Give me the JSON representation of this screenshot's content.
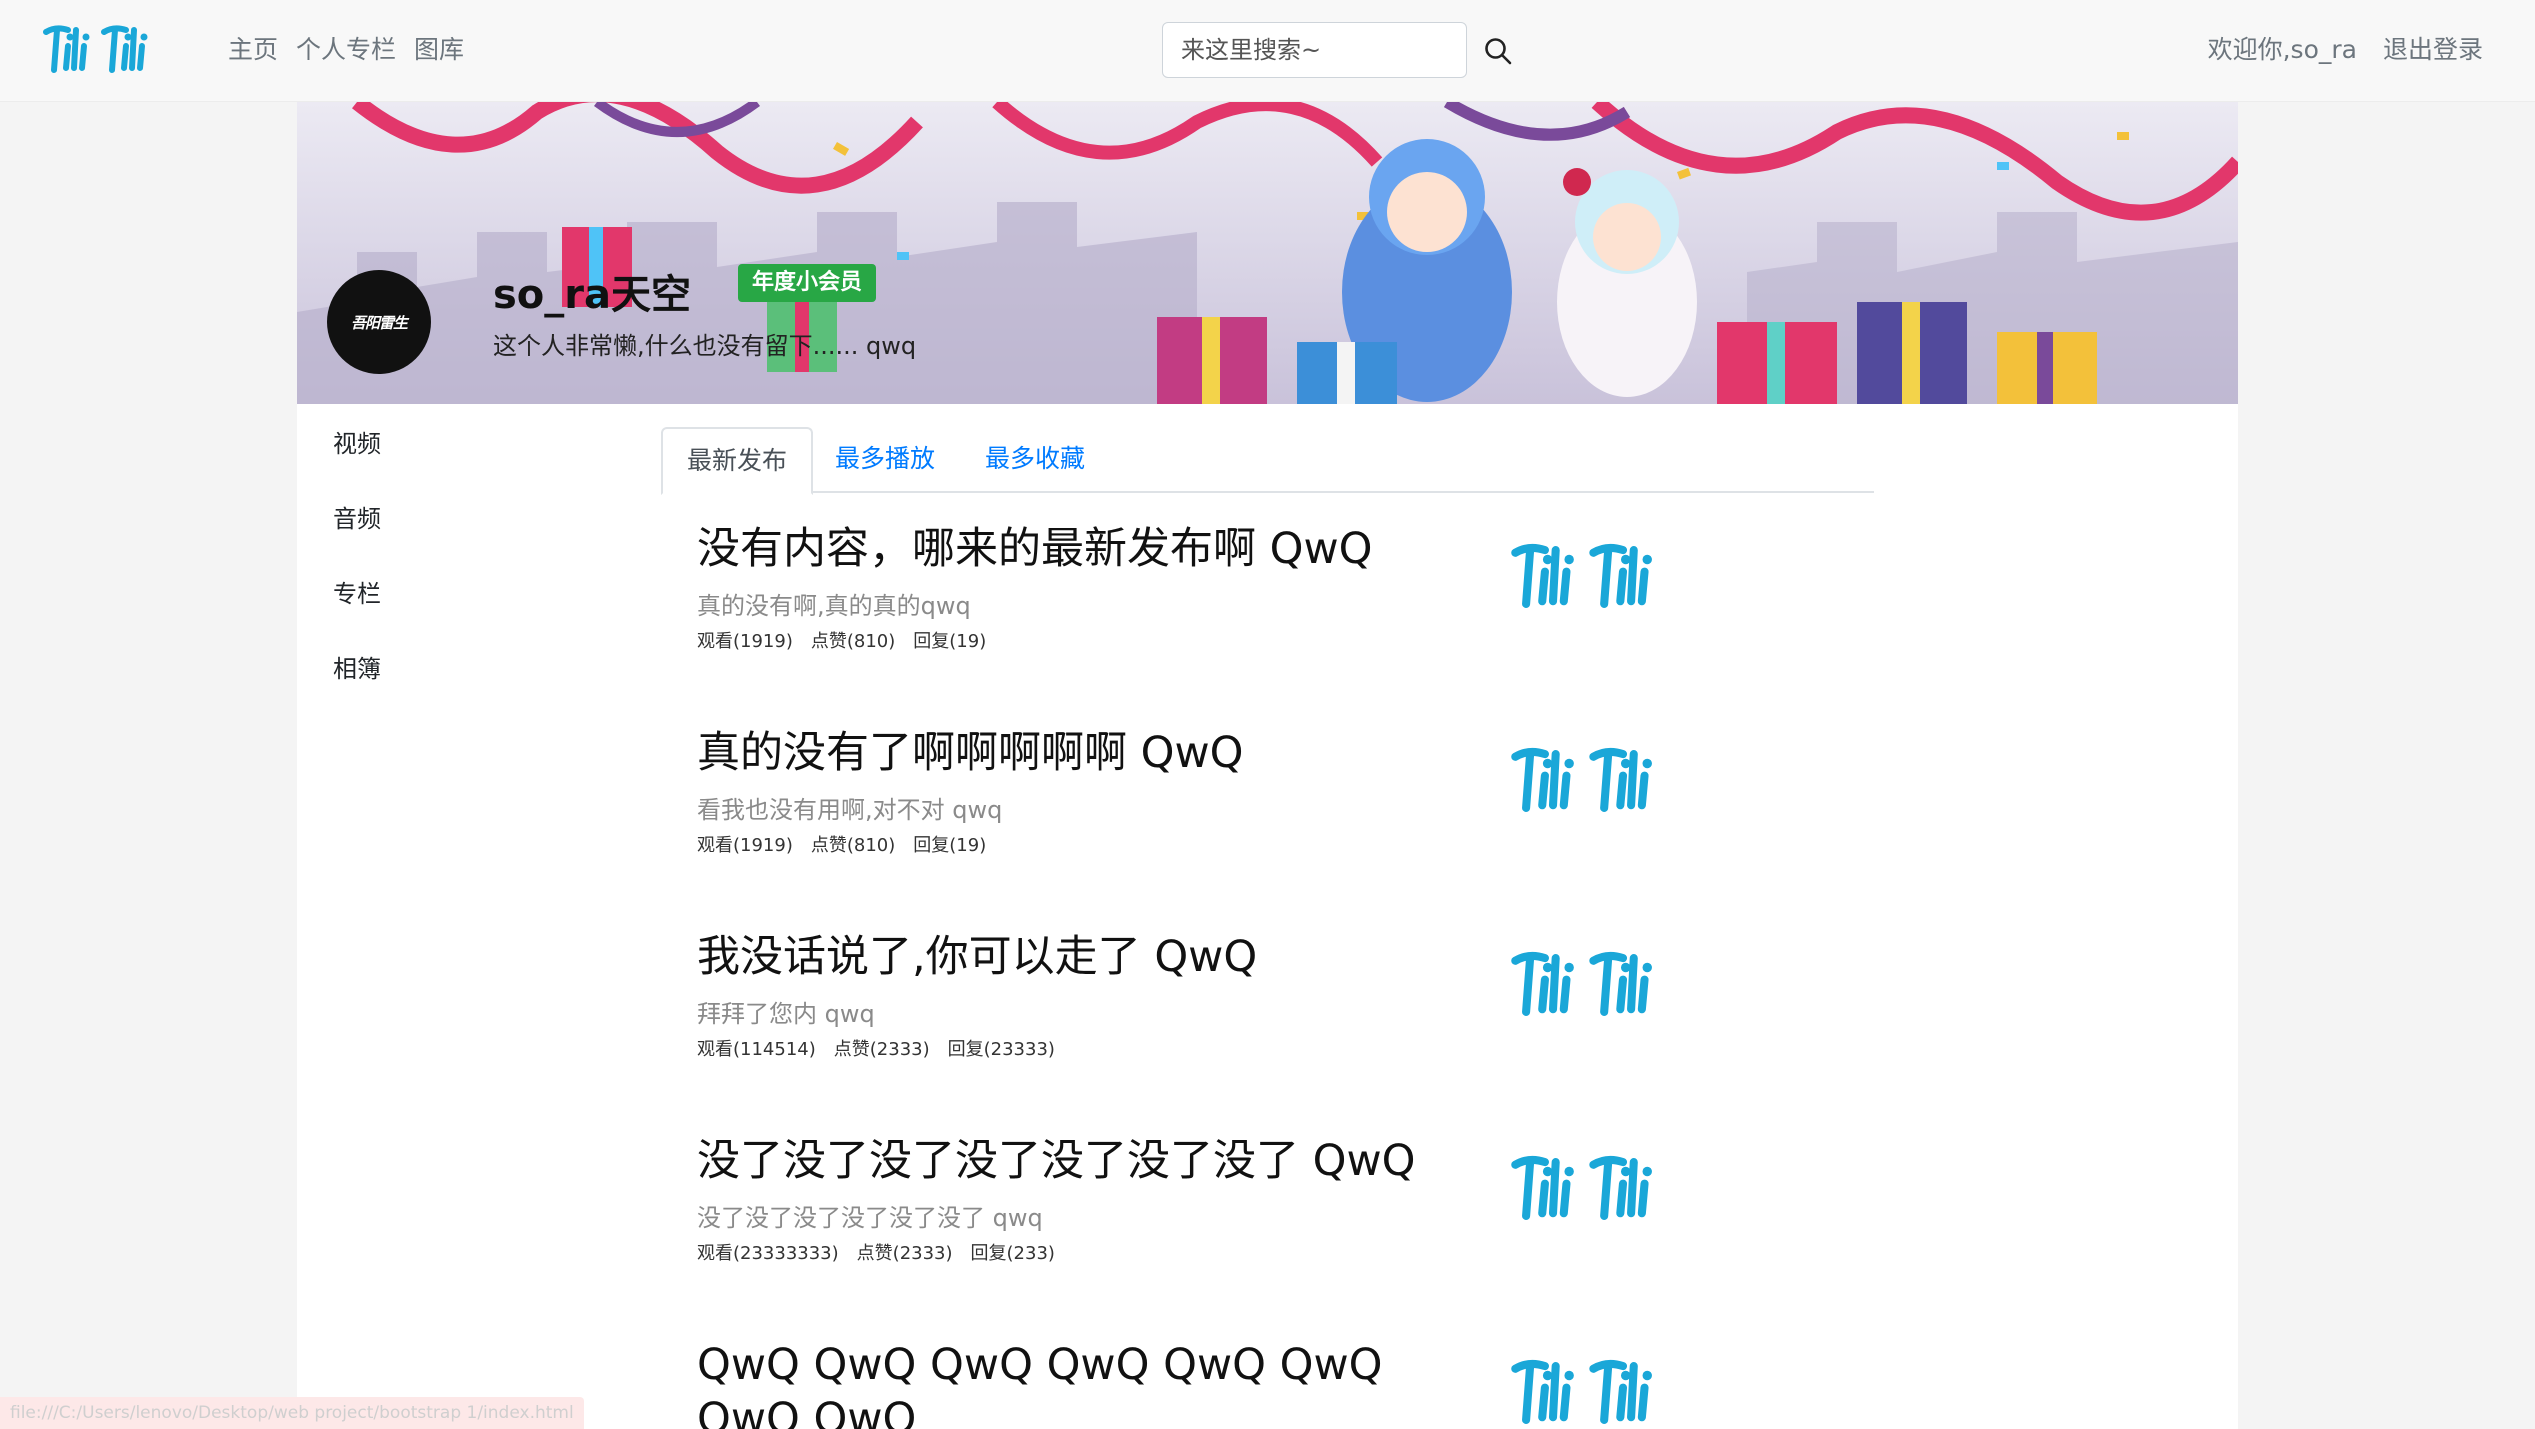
{
  "navbar": {
    "brand": "Tili Tili",
    "links": [
      "主页",
      "个人专栏",
      "图库"
    ],
    "search_placeholder": "来这里搜索~",
    "welcome": "欢迎你,so_ra",
    "logout": "退出登录"
  },
  "profile": {
    "avatar_text": "吾阳雷生",
    "name": "so_ra天空",
    "badge": "年度小会员",
    "signature": "这个人非常懒,什么也没有留下...... qwq"
  },
  "sidebar": {
    "items": [
      "视频",
      "音频",
      "专栏",
      "相簿"
    ]
  },
  "tabs": [
    "最新发布",
    "最多播放",
    "最多收藏"
  ],
  "articles": [
    {
      "title": "没有内容，哪来的最新发布啊 QwQ",
      "desc": "真的没有啊,真的真的qwq",
      "views": "观看(1919)",
      "likes": "点赞(810)",
      "replies": "回复(19)"
    },
    {
      "title": "真的没有了啊啊啊啊啊 QwQ",
      "desc": "看我也没有用啊,对不对 qwq",
      "views": "观看(1919)",
      "likes": "点赞(810)",
      "replies": "回复(19)"
    },
    {
      "title": "我没话说了,你可以走了 QwQ",
      "desc": "拜拜了您内 qwq",
      "views": "观看(114514)",
      "likes": "点赞(2333)",
      "replies": "回复(23333)"
    },
    {
      "title": "没了没了没了没了没了没了没了 QwQ",
      "desc": "没了没了没了没了没了没了 qwq",
      "views": "观看(23333333)",
      "likes": "点赞(2333)",
      "replies": "回复(233)"
    },
    {
      "title": "QwQ QwQ QwQ QwQ QwQ QwQ",
      "title2": "QwQ QwQ",
      "desc": "",
      "views": "",
      "likes": "",
      "replies": ""
    }
  ],
  "thumbnail_logo": "Tili Tili",
  "status_url": "file:///C:/Users/lenovo/Desktop/web project/bootstrap 1/index.html",
  "colors": {
    "brand": "#1aa7d8",
    "badge": "#28a745",
    "link": "#007bff"
  }
}
